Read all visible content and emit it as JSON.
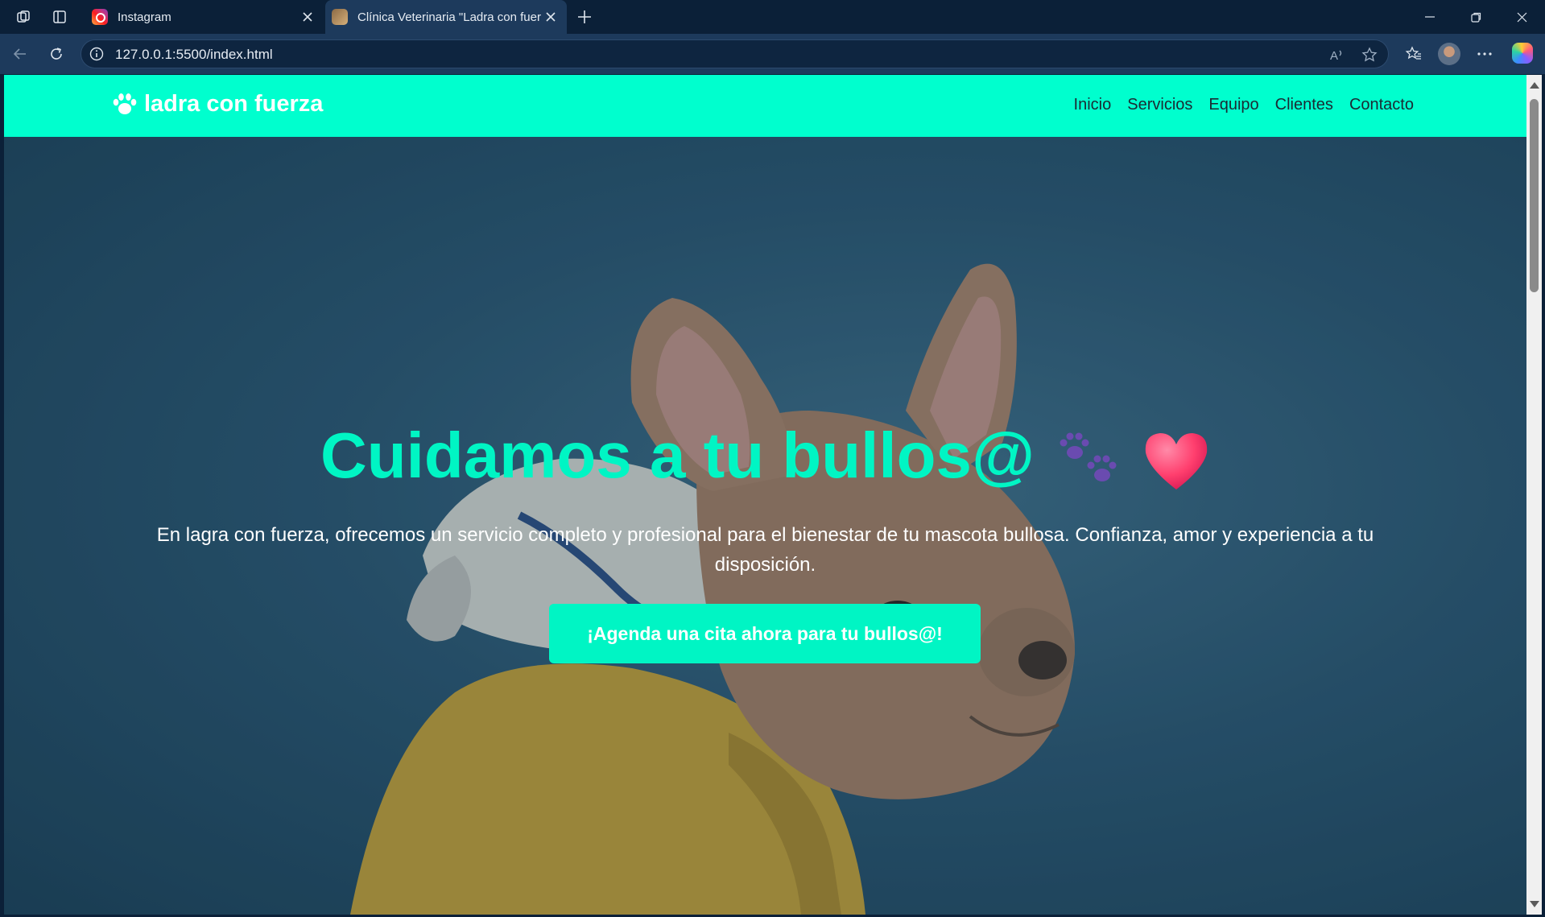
{
  "browser": {
    "tabs": [
      {
        "title": "Instagram",
        "icon": "instagram-icon",
        "active": false
      },
      {
        "title": "Clínica Veterinaria \"Ladra con fuer",
        "icon": "vet-clinic-favicon",
        "active": true
      }
    ],
    "url": "127.0.0.1:5500/index.html"
  },
  "site": {
    "brand": "ladra con fuerza",
    "nav": [
      "Inicio",
      "Servicios",
      "Equipo",
      "Clientes",
      "Contacto"
    ],
    "hero": {
      "title": "Cuidamos a tu bullos@",
      "text": "En lagra con fuerza, ofrecemos un servicio completo y profesional para el bienestar de tu mascota bullosa. Confianza, amor y experiencia a tu disposición.",
      "cta": "¡Agenda una cita ahora para tu bullos@!"
    }
  },
  "colors": {
    "accent": "#00ffce",
    "title": "#00f5c4",
    "chrome": "#0b2038"
  }
}
